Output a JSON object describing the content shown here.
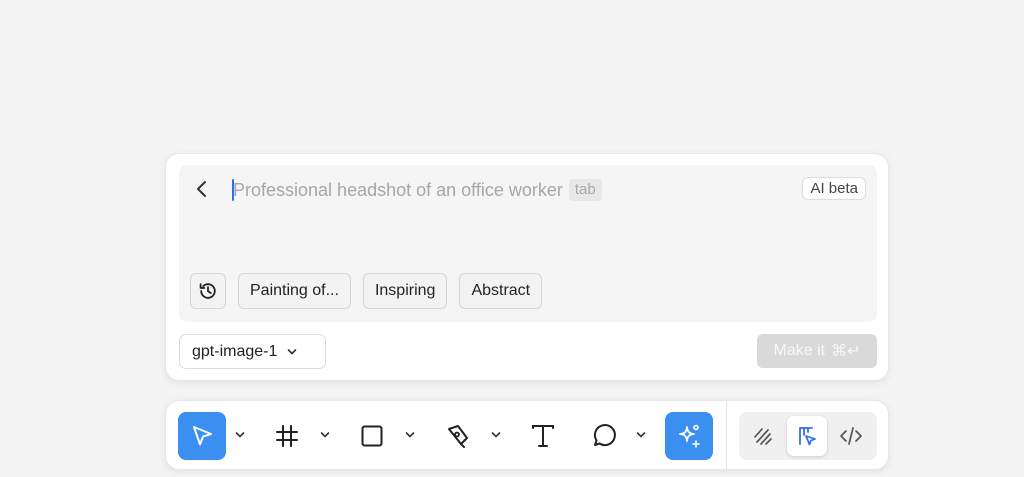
{
  "prompt": {
    "placeholder": "Professional headshot of an office worker",
    "tab_hint": "tab",
    "ai_badge": "AI beta",
    "suggestions": [
      "Painting of...",
      "Inspiring",
      "Abstract"
    ]
  },
  "footer": {
    "model": "gpt-image-1",
    "make_label": "Make it",
    "make_shortcut": "⌘↵"
  },
  "toolbar": {
    "tools": [
      "move-icon",
      "frame-icon",
      "rectangle-icon",
      "pen-icon",
      "text-icon",
      "comment-icon",
      "ai-sparkle-icon"
    ],
    "active_tool": "move-icon",
    "modes": [
      "draw-icon",
      "design-icon",
      "code-icon"
    ],
    "active_mode": "design-icon"
  },
  "colors": {
    "accent": "#3b8ff0",
    "caret": "#2f6fed",
    "background": "#f4f4f4",
    "disabled_button": "#d9d9d9"
  }
}
